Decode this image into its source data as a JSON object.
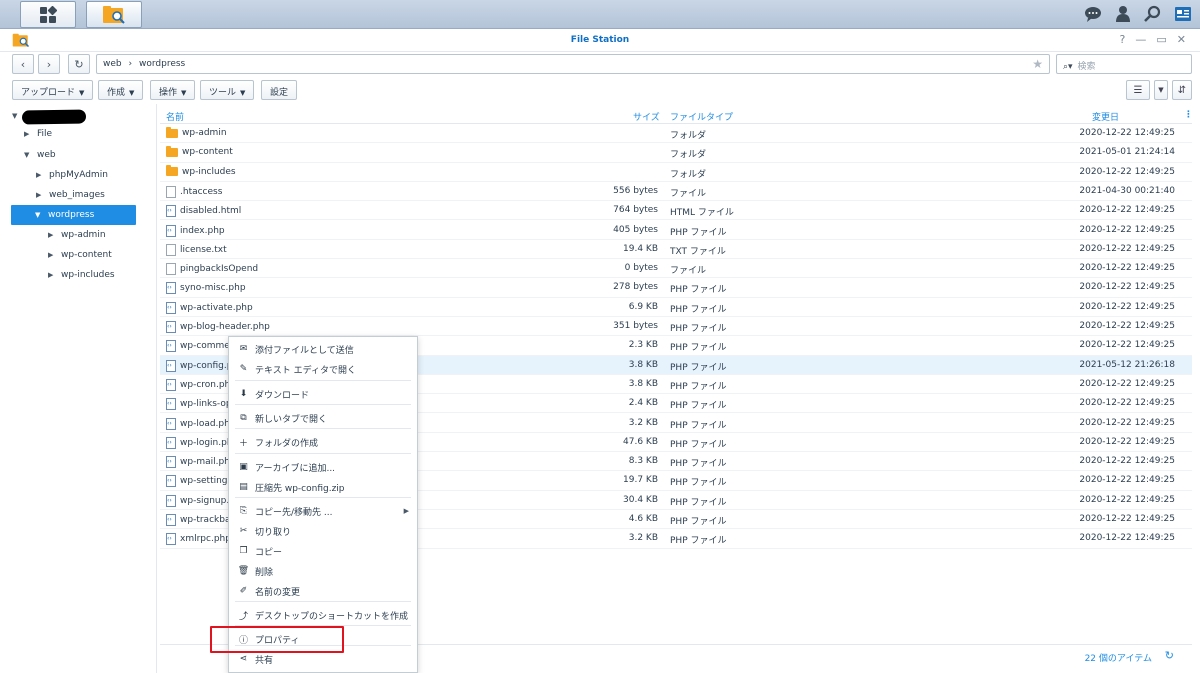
{
  "taskbar": {
    "left_buttons": [
      {
        "icon": "main-menu-icon"
      },
      {
        "icon": "file-station-icon"
      }
    ],
    "right_icons": [
      "chat-icon",
      "user-icon",
      "search-icon",
      "widgets-icon"
    ]
  },
  "window": {
    "title": "File Station",
    "controls": [
      "?",
      "—",
      "▭",
      "✕"
    ]
  },
  "navbar": {
    "path": [
      "web",
      "wordpress"
    ],
    "path_sep": "›",
    "search_placeholder": "検索"
  },
  "toolbar": {
    "buttons": [
      "アップロード",
      "作成",
      "操作",
      "ツール",
      "設定"
    ]
  },
  "tree": {
    "nodes": [
      {
        "label": "File"
      },
      {
        "label": "web"
      },
      {
        "label": "phpMyAdmin"
      },
      {
        "label": "web_images"
      },
      {
        "label": "wordpress"
      },
      {
        "label": "wp-admin"
      },
      {
        "label": "wp-content"
      },
      {
        "label": "wp-includes"
      }
    ]
  },
  "list": {
    "columns": {
      "name": "名前",
      "size": "サイズ",
      "type": "ファイルタイプ",
      "modified": "変更日"
    },
    "rows": [
      {
        "name": "wp-admin",
        "size": "",
        "type": "フォルダ",
        "modified": "2020-12-22 12:49:25",
        "icon": "folder-icon"
      },
      {
        "name": "wp-content",
        "size": "",
        "type": "フォルダ",
        "modified": "2021-05-01 21:24:14",
        "icon": "folder-icon"
      },
      {
        "name": "wp-includes",
        "size": "",
        "type": "フォルダ",
        "modified": "2020-12-22 12:49:25",
        "icon": "folder-icon"
      },
      {
        "name": ".htaccess",
        "size": "556 bytes",
        "type": "ファイル",
        "modified": "2021-04-30 00:21:40",
        "icon": "file-icon"
      },
      {
        "name": "disabled.html",
        "size": "764 bytes",
        "type": "HTML ファイル",
        "modified": "2020-12-22 12:49:25",
        "icon": "html-file-icon"
      },
      {
        "name": "index.php",
        "size": "405 bytes",
        "type": "PHP ファイル",
        "modified": "2020-12-22 12:49:25",
        "icon": "php-file-icon"
      },
      {
        "name": "license.txt",
        "size": "19.4 KB",
        "type": "TXT ファイル",
        "modified": "2020-12-22 12:49:25",
        "icon": "txt-file-icon"
      },
      {
        "name": "pingbackIsOpend",
        "size": "0 bytes",
        "type": "ファイル",
        "modified": "2020-12-22 12:49:25",
        "icon": "file-icon"
      },
      {
        "name": "syno-misc.php",
        "size": "278 bytes",
        "type": "PHP ファイル",
        "modified": "2020-12-22 12:49:25",
        "icon": "php-file-icon"
      },
      {
        "name": "wp-activate.php",
        "size": "6.9 KB",
        "type": "PHP ファイル",
        "modified": "2020-12-22 12:49:25",
        "icon": "php-file-icon"
      },
      {
        "name": "wp-blog-header.php",
        "size": "351 bytes",
        "type": "PHP ファイル",
        "modified": "2020-12-22 12:49:25",
        "icon": "php-file-icon"
      },
      {
        "name": "wp-commen",
        "size": "2.3 KB",
        "type": "PHP ファイル",
        "modified": "2020-12-22 12:49:25",
        "icon": "php-file-icon"
      },
      {
        "name": "wp-config.ph",
        "size": "3.8 KB",
        "type": "PHP ファイル",
        "modified": "2021-05-12 21:26:18",
        "icon": "php-file-icon"
      },
      {
        "name": "wp-cron.php",
        "size": "3.8 KB",
        "type": "PHP ファイル",
        "modified": "2020-12-22 12:49:25",
        "icon": "php-file-icon"
      },
      {
        "name": "wp-links-opn",
        "size": "2.4 KB",
        "type": "PHP ファイル",
        "modified": "2020-12-22 12:49:25",
        "icon": "php-file-icon"
      },
      {
        "name": "wp-load.php",
        "size": "3.2 KB",
        "type": "PHP ファイル",
        "modified": "2020-12-22 12:49:25",
        "icon": "php-file-icon"
      },
      {
        "name": "wp-login.php",
        "size": "47.6 KB",
        "type": "PHP ファイル",
        "modified": "2020-12-22 12:49:25",
        "icon": "php-file-icon"
      },
      {
        "name": "wp-mail.php",
        "size": "8.3 KB",
        "type": "PHP ファイル",
        "modified": "2020-12-22 12:49:25",
        "icon": "php-file-icon"
      },
      {
        "name": "wp-settings.",
        "size": "19.7 KB",
        "type": "PHP ファイル",
        "modified": "2020-12-22 12:49:25",
        "icon": "php-file-icon"
      },
      {
        "name": "wp-signup.p",
        "size": "30.4 KB",
        "type": "PHP ファイル",
        "modified": "2020-12-22 12:49:25",
        "icon": "php-file-icon"
      },
      {
        "name": "wp-trackbac",
        "size": "4.6 KB",
        "type": "PHP ファイル",
        "modified": "2020-12-22 12:49:25",
        "icon": "php-file-icon"
      },
      {
        "name": "xmlrpc.php",
        "size": "3.2 KB",
        "type": "PHP ファイル",
        "modified": "2020-12-22 12:49:25",
        "icon": "php-file-icon"
      }
    ],
    "selected_row": "wp-config.ph",
    "item_count": "22 個のアイテム"
  },
  "context_menu": {
    "items": [
      {
        "label": "添付ファイルとして送信",
        "icon": "mail-icon"
      },
      {
        "label": "テキスト エディタで開く",
        "icon": "edit-icon"
      },
      {
        "label": "ダウンロード",
        "icon": "download-icon"
      },
      {
        "label": "新しいタブで開く",
        "icon": "new-tab-icon"
      },
      {
        "label": "フォルダの作成",
        "icon": "create-folder-icon"
      },
      {
        "label": "アーカイブに追加...",
        "icon": "archive-icon"
      },
      {
        "label": "圧縮先 wp-config.zip",
        "icon": "compress-icon"
      },
      {
        "label": "コピー先/移動先 ...",
        "icon": "copy-move-icon",
        "submenu": true
      },
      {
        "label": "切り取り",
        "icon": "cut-icon"
      },
      {
        "label": "コピー",
        "icon": "copy-icon"
      },
      {
        "label": "削除",
        "icon": "delete-icon"
      },
      {
        "label": "名前の変更",
        "icon": "rename-icon"
      },
      {
        "label": "デスクトップのショートカットを作成",
        "icon": "shortcut-icon"
      },
      {
        "label": "プロパティ",
        "icon": "info-icon",
        "highlighted": true
      },
      {
        "label": "共有",
        "icon": "share-icon"
      }
    ]
  },
  "colors": {
    "accent": "#1f8de4",
    "title": "#0f6fc6",
    "folder": "#f5a623",
    "highlight_box": "#e0141e"
  }
}
